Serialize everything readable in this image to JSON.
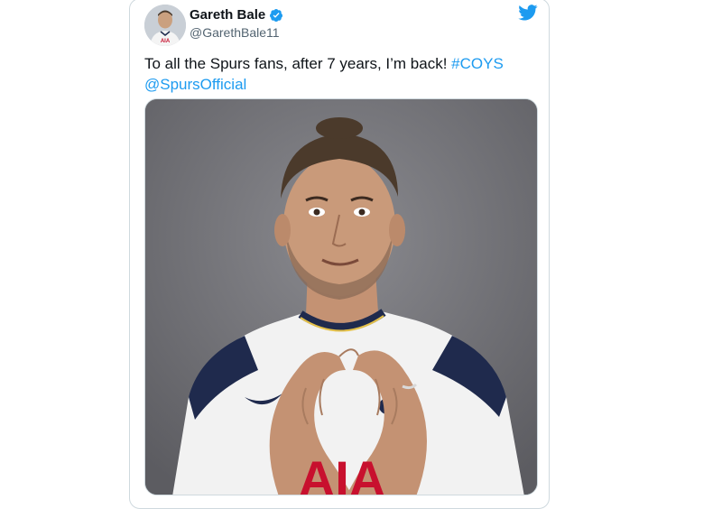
{
  "tweet": {
    "display_name": "Gareth Bale",
    "handle": "@GarethBale11",
    "text_before": "To all the Spurs fans, after 7 years, I’m back! ",
    "hashtag": "#COYS",
    "mention": "@SpursOfficial",
    "verified": true
  },
  "icons": {
    "verified": "verified-badge-icon",
    "platform": "twitter-bird-icon"
  },
  "colors": {
    "link": "#1d9bf0",
    "verified": "#1d9bf0",
    "photo_background": "#6f6f74",
    "shirt": "#f2f2f2",
    "shirt_accent": "#1f2a4d",
    "sponsor": "#c8102e"
  },
  "media": {
    "sponsor_text": "AIA"
  }
}
